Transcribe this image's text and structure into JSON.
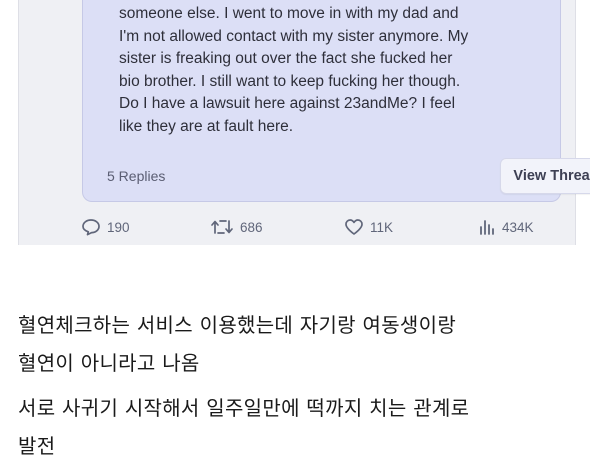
{
  "post": {
    "body": "someone else. I went to move in with my dad and\nI'm not allowed contact with my sister anymore. My\nsister is freaking out over the fact she fucked her\nbio brother. I still want to keep fucking her though.\nDo I have a lawsuit here against 23andMe? I feel\nlike they are at fault here.",
    "replies_label": "5 Replies",
    "view_thread_label": "View Thread"
  },
  "stats": {
    "comments": "190",
    "reposts": "686",
    "likes": "11K",
    "views": "434K"
  },
  "caption": {
    "line1": "혈연체크하는 서비스 이용했는데 자기랑 여동생이랑",
    "line2": "혈연이 아니라고 나옴",
    "line3": "서로 사귀기 시작해서 일주일만에 떡까지 치는 관계로",
    "line4": "발전"
  },
  "colors": {
    "card_bg": "#dcdff6",
    "panel_bg": "#eff0f4",
    "stat_text": "#60667a"
  },
  "icons": [
    "comment-icon",
    "repost-icon",
    "heart-icon",
    "views-chart-icon"
  ]
}
